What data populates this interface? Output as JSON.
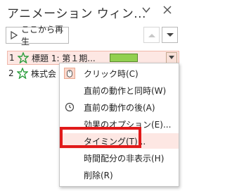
{
  "pane": {
    "title": "アニメーション ウィン...",
    "play_button_label": "ここから再生"
  },
  "animations": [
    {
      "number": "1",
      "label": "標題 1: 第１期...",
      "selected": true
    },
    {
      "number": "2",
      "label": "株式会"
    }
  ],
  "context_menu": {
    "items": [
      {
        "label": "クリック時(C)",
        "icon": "mouse-click-icon",
        "checked": true
      },
      {
        "label": "直前の動作と同時(W)"
      },
      {
        "label": "直前の動作の後(A)",
        "icon": "clock-icon"
      },
      {
        "label": "効果のオプション(E)..."
      },
      {
        "label": "タイミング(T)...",
        "hovered": true
      },
      {
        "label": "時間配分の非表示(H)"
      },
      {
        "label": "削除(R)"
      }
    ]
  },
  "colors": {
    "accent": "#f0b7aa",
    "selection_bg": "#fde7e3",
    "timing_bar": "#92d050",
    "star": "#2e9e3e",
    "highlight": "#e11a1a"
  }
}
